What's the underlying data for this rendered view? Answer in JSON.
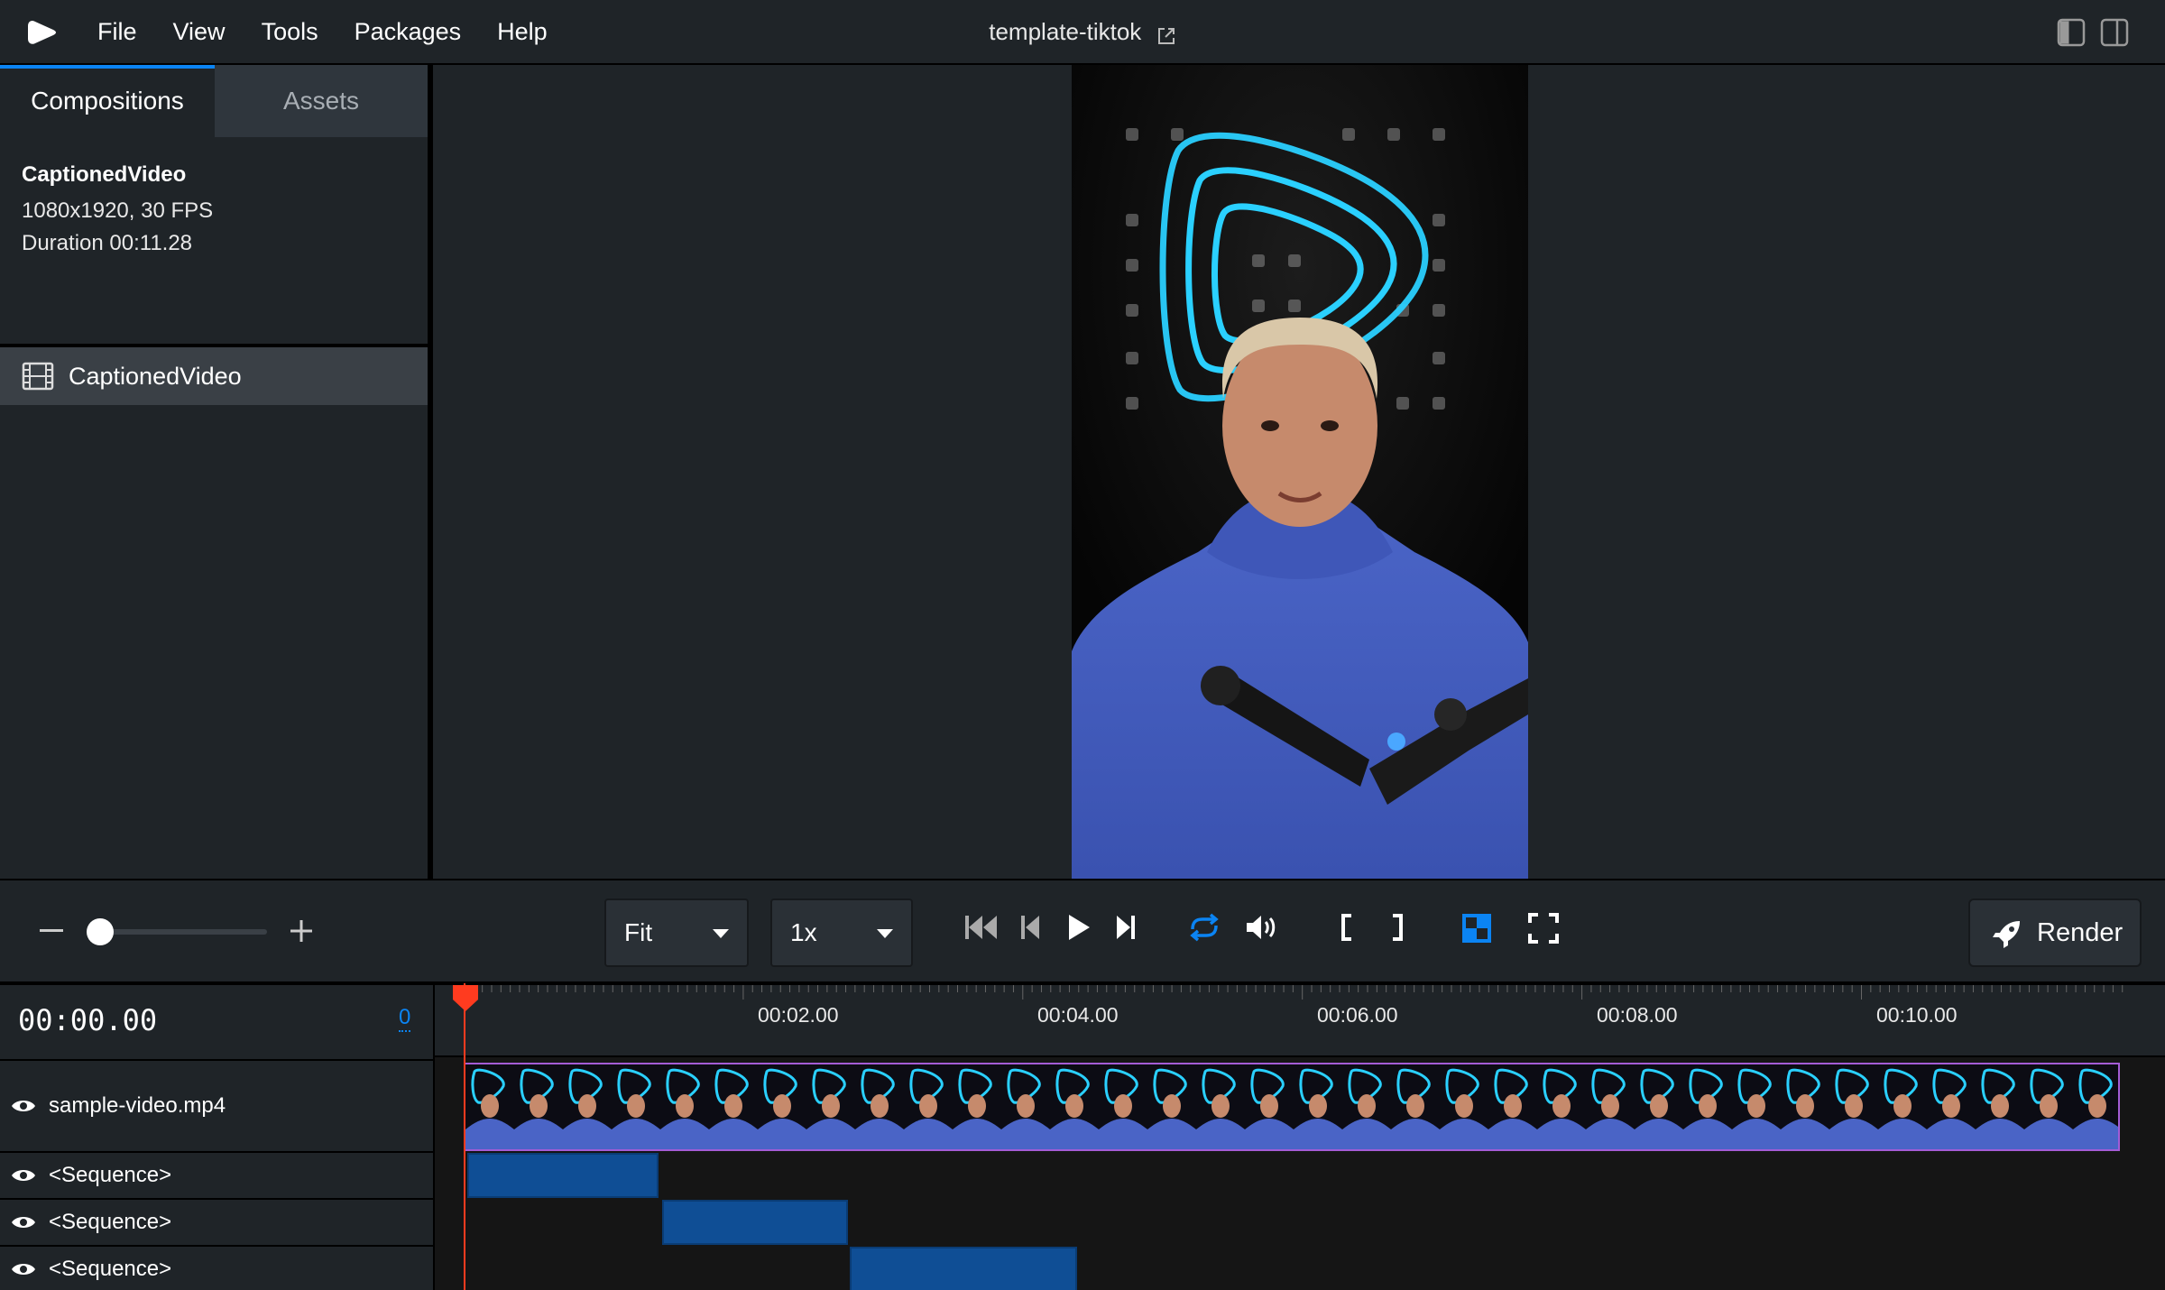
{
  "menubar": {
    "items": [
      "File",
      "View",
      "Tools",
      "Packages",
      "Help"
    ],
    "title": "template-tiktok"
  },
  "sidebar": {
    "tabs": [
      "Compositions",
      "Assets"
    ],
    "active_tab": "Compositions",
    "composition": {
      "name": "CaptionedVideo",
      "resolution": "1080x1920, 30 FPS",
      "duration": "Duration 00:11.28"
    },
    "list": [
      {
        "label": "CaptionedVideo",
        "selected": true
      }
    ]
  },
  "controls": {
    "size_select": "Fit",
    "speed_select": "1x",
    "render_label": "Render",
    "accent_color": "#0b84f3",
    "zoom_level": 0.1
  },
  "timeline": {
    "timecode": "00:00.00",
    "frame": "0",
    "ruler_labels": [
      "00:02.00",
      "00:04.00",
      "00:06.00",
      "00:08.00",
      "00:10.00"
    ],
    "tracks": [
      {
        "label": "sample-video.mp4"
      },
      {
        "label": "<Sequence>"
      },
      {
        "label": "<Sequence>"
      },
      {
        "label": "<Sequence>"
      }
    ],
    "playhead_color": "#ff3b1f",
    "sequence_color": "#0f4e95"
  }
}
